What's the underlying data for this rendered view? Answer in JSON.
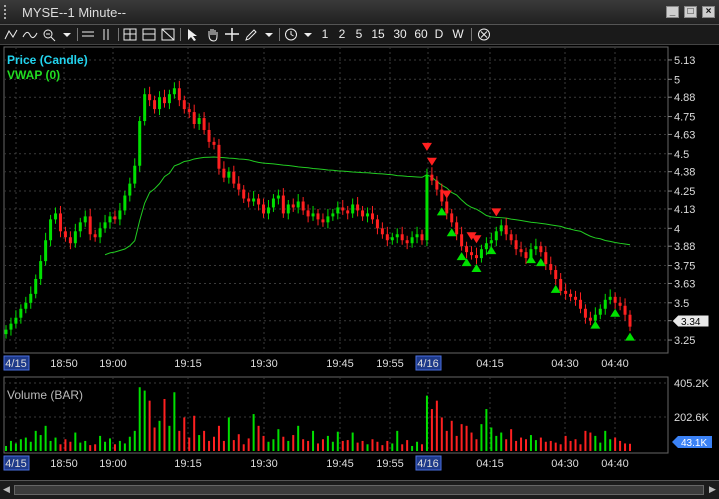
{
  "window": {
    "title": "MYSE--1 Minute--"
  },
  "toolbar": {
    "intervals": [
      "1",
      "2",
      "5",
      "15",
      "30",
      "60",
      "D",
      "W"
    ]
  },
  "chart": {
    "price_label": "Price (Candle)",
    "vwap_label": "VWAP (0)",
    "volume_label": "Volume (BAR)",
    "price_ticks": [
      "5.13",
      "5",
      "4.88",
      "4.75",
      "4.63",
      "4.5",
      "4.38",
      "4.25",
      "4.13",
      "4",
      "3.88",
      "3.75",
      "3.63",
      "3.5",
      "3.38",
      "3.25"
    ],
    "volume_ticks": [
      "405.2K",
      "202.6K"
    ],
    "current_price": "3.34",
    "current_volume": "43.1K",
    "time_labels": [
      "4/15",
      "18:50",
      "19:00",
      "19:15",
      "19:30",
      "19:45",
      "19:55",
      "4/16",
      "04:15",
      "04:30",
      "04:40"
    ],
    "colors": {
      "up": "#00e000",
      "down": "#ff2020",
      "vwap": "#22cc22",
      "grid": "#3a3a3a",
      "price_label": "#22d3ee",
      "vwap_label": "#22dd22"
    }
  },
  "chart_data": [
    {
      "type": "candlestick",
      "title": "Price (Candle)",
      "ylim": [
        3.19,
        5.19
      ],
      "close": [
        3.32,
        3.36,
        3.4,
        3.46,
        3.5,
        3.56,
        3.66,
        3.78,
        3.92,
        4.06,
        4.1,
        3.98,
        3.94,
        3.9,
        3.98,
        4.04,
        4.08,
        3.96,
        3.94,
        4.0,
        4.04,
        4.08,
        4.06,
        4.12,
        4.22,
        4.3,
        4.42,
        4.72,
        4.9,
        4.86,
        4.8,
        4.88,
        4.84,
        4.9,
        4.94,
        4.86,
        4.8,
        4.78,
        4.7,
        4.74,
        4.66,
        4.58,
        4.56,
        4.4,
        4.34,
        4.38,
        4.3,
        4.26,
        4.2,
        4.18,
        4.2,
        4.16,
        4.1,
        4.14,
        4.2,
        4.22,
        4.1,
        4.16,
        4.14,
        4.18,
        4.12,
        4.08,
        4.1,
        4.06,
        4.04,
        4.08,
        4.1,
        4.14,
        4.12,
        4.1,
        4.16,
        4.12,
        4.08,
        4.1,
        4.06,
        4.0,
        3.96,
        3.92,
        3.94,
        3.96,
        3.92,
        3.9,
        3.94,
        3.96,
        3.92,
        4.36,
        4.32,
        4.26,
        4.18,
        4.1,
        4.04,
        3.96,
        3.88,
        3.84,
        3.82,
        3.8,
        3.86,
        3.9,
        3.92,
        3.98,
        4.02,
        3.96,
        3.92,
        3.86,
        3.84,
        3.8,
        3.86,
        3.88,
        3.84,
        3.76,
        3.72,
        3.66,
        3.58,
        3.56,
        3.54,
        3.52,
        3.46,
        3.4,
        3.38,
        3.42,
        3.46,
        3.52,
        3.54,
        3.5,
        3.48,
        3.42,
        3.34
      ],
      "volume_ylim": [
        0,
        405.2
      ],
      "volume_k": [
        30,
        60,
        45,
        70,
        80,
        55,
        120,
        95,
        150,
        60,
        80,
        40,
        70,
        55,
        110,
        50,
        60,
        35,
        40,
        90,
        55,
        75,
        40,
        60,
        45,
        85,
        120,
        380,
        360,
        300,
        140,
        180,
        310,
        150,
        350,
        120,
        200,
        80,
        210,
        95,
        120,
        60,
        85,
        150,
        60,
        200,
        65,
        100,
        40,
        75,
        220,
        150,
        90,
        55,
        70,
        130,
        85,
        60,
        95,
        150,
        70,
        60,
        120,
        45,
        70,
        90,
        55,
        115,
        60,
        65,
        110,
        50,
        60,
        40,
        70,
        55,
        35,
        60,
        45,
        120,
        40,
        65,
        30,
        55,
        40,
        330,
        250,
        300,
        200,
        120,
        180,
        90,
        160,
        150,
        110,
        70,
        160,
        250,
        140,
        90,
        110,
        70,
        130,
        60,
        80,
        70,
        95,
        65,
        80,
        55,
        60,
        50,
        40,
        90,
        60,
        70,
        40,
        120,
        110,
        90,
        50,
        120,
        70,
        80,
        60,
        45,
        43
      ]
    }
  ]
}
